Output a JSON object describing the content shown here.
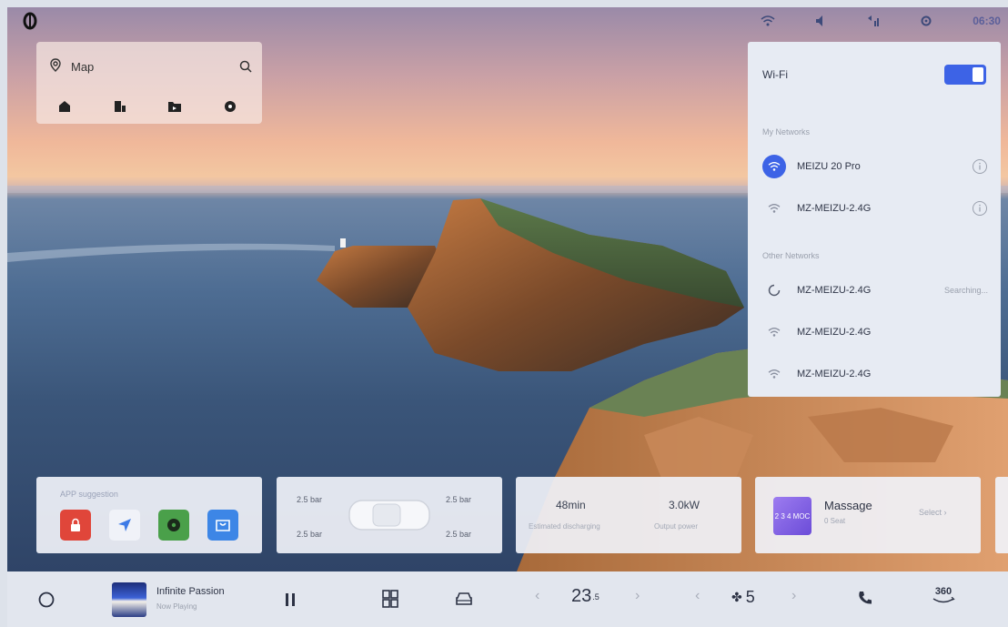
{
  "map_widget": {
    "search_label": "Map"
  },
  "status_bar": {
    "time": "06:30"
  },
  "wifi_panel": {
    "title": "Wi-Fi",
    "enabled": true,
    "my_networks_label": "My Networks",
    "my_networks": [
      {
        "name": "MEIZU 20 Pro",
        "connected": true
      },
      {
        "name": "MZ-MEIZU-2.4G",
        "connected": false
      }
    ],
    "other_networks_label": "Other Networks",
    "other_networks": [
      {
        "name": "MZ-MEIZU-2.4G",
        "status": "Searching..."
      },
      {
        "name": "MZ-MEIZU-2.4G",
        "status": ""
      },
      {
        "name": "MZ-MEIZU-2.4G",
        "status": ""
      }
    ]
  },
  "cards": {
    "apps": {
      "title": "APP suggestion"
    },
    "tire": {
      "front_left": "2.5 bar",
      "front_right": "2.5 bar",
      "rear_left": "2.5 bar",
      "rear_right": "2.5 bar"
    },
    "charge": {
      "time_value": "48min",
      "time_label": "Estimated discharging",
      "power_value": "3.0kW",
      "power_label": "Output power"
    },
    "massage": {
      "thumb_text": "2 3 4\nMOC",
      "title": "Massage",
      "subtitle": "0 Seat",
      "action": "Select ›"
    }
  },
  "dock": {
    "media_title": "Infinite Passion",
    "media_subtitle": "Now Playing",
    "temperature": "23",
    "temperature_unit": ".5",
    "fan_level": "5",
    "view_360": "360"
  },
  "colors": {
    "accent": "#3d63e6",
    "panel_bg": "#e7ebf3"
  }
}
